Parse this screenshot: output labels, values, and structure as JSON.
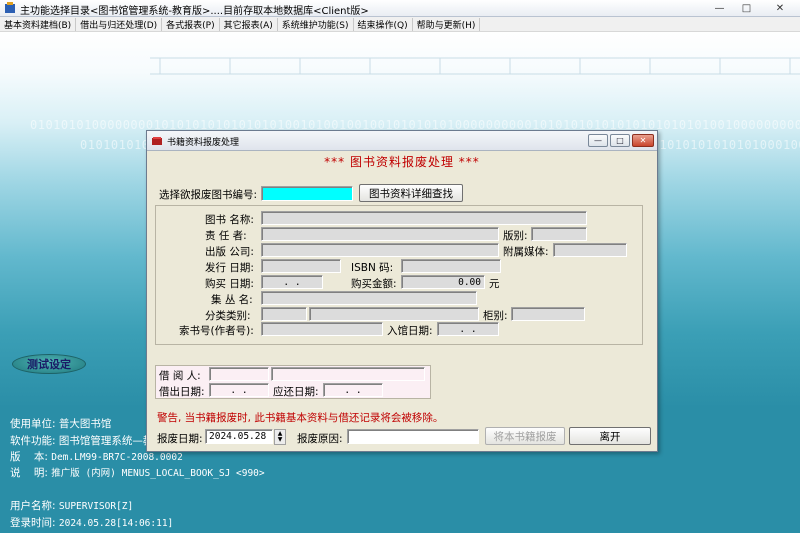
{
  "window": {
    "title": "主功能选择目录<图书馆管理系统-教育版>....目前存取本地数据库<Client版>",
    "min_glyph": "—",
    "max_glyph": "□",
    "close_glyph": "✕"
  },
  "menu": [
    {
      "label": "基本资料建档(B)"
    },
    {
      "label": "借出与归还处理(D)"
    },
    {
      "label": "各式报表(P)"
    },
    {
      "label": "其它报表(A)"
    },
    {
      "label": "系统维护功能(S)"
    },
    {
      "label": "结束操作(Q)"
    },
    {
      "label": "帮助与更新(H)"
    }
  ],
  "desktop": {
    "binary_row1": "0101010100000000101010101010101010010100100100101010101000000000010101010101010101010101001000000000",
    "binary_row2": "0101010100000001010101010010001010101000101001010101010101000101010010101001010101010101000100",
    "test_button": "测试设定",
    "info": {
      "unit_label": "使用单位:",
      "unit_value": "普大图书馆",
      "func_label": "软件功能:",
      "func_value": "图书馆管理系统—教",
      "ver_label": "版    本:",
      "ver_value": "Dem.LM99-BR7C-2008.0002",
      "desc_label": "说    明:",
      "desc_value": "推广版 (内网) MENUS_LOCAL_BOOK_SJ <990>",
      "user_label": "用户名称:",
      "user_value": "SUPERVISOR[Z]",
      "login_label": "登录时间:",
      "login_value": "2024.05.28[14:06:11]"
    }
  },
  "dialog": {
    "title": "书籍资料报废处理",
    "heading": "*** 图书资料报废处理 ***",
    "select_label": "选择欲报废图书编号:",
    "select_value": "",
    "detail_button": "图书资料详细查找",
    "fields": {
      "book_name": "图书 名称:",
      "author": "责  任  者:",
      "edition": "版别:",
      "publisher": "出版 公司:",
      "media": "附属媒体:",
      "issue_date": "发行 日期:",
      "isbn": "ISBN  码:",
      "buy_date": "购买 日期:",
      "buy_date_value": ". .",
      "buy_amount": "购买金额:",
      "buy_amount_value": "0.00",
      "currency": "元",
      "series": "集 丛 名:",
      "category": "分类类别:",
      "shelf": "柜别:",
      "call_no": "索书号(作者号):",
      "in_date": "入馆日期:",
      "in_date_value": ". ."
    },
    "borrow": {
      "borrower": "借  阅  人:",
      "borrow_date": "借出日期:",
      "borrow_date_value": ". .",
      "return_date": "应还日期:",
      "return_date_value": ". ."
    },
    "warning": "警告, 当书籍报废时, 此书籍基本资料与借还记录将会被移除。",
    "scrap_date_label": "报废日期:",
    "scrap_date_value": "2024.05.28",
    "scrap_reason_label": "报废原因:",
    "scrap_button": "将本书籍报废",
    "leave_button": "离开",
    "min_glyph": "—",
    "max_glyph": "□",
    "close_glyph": "✕",
    "spin_up": "▲",
    "spin_down": "▼"
  }
}
